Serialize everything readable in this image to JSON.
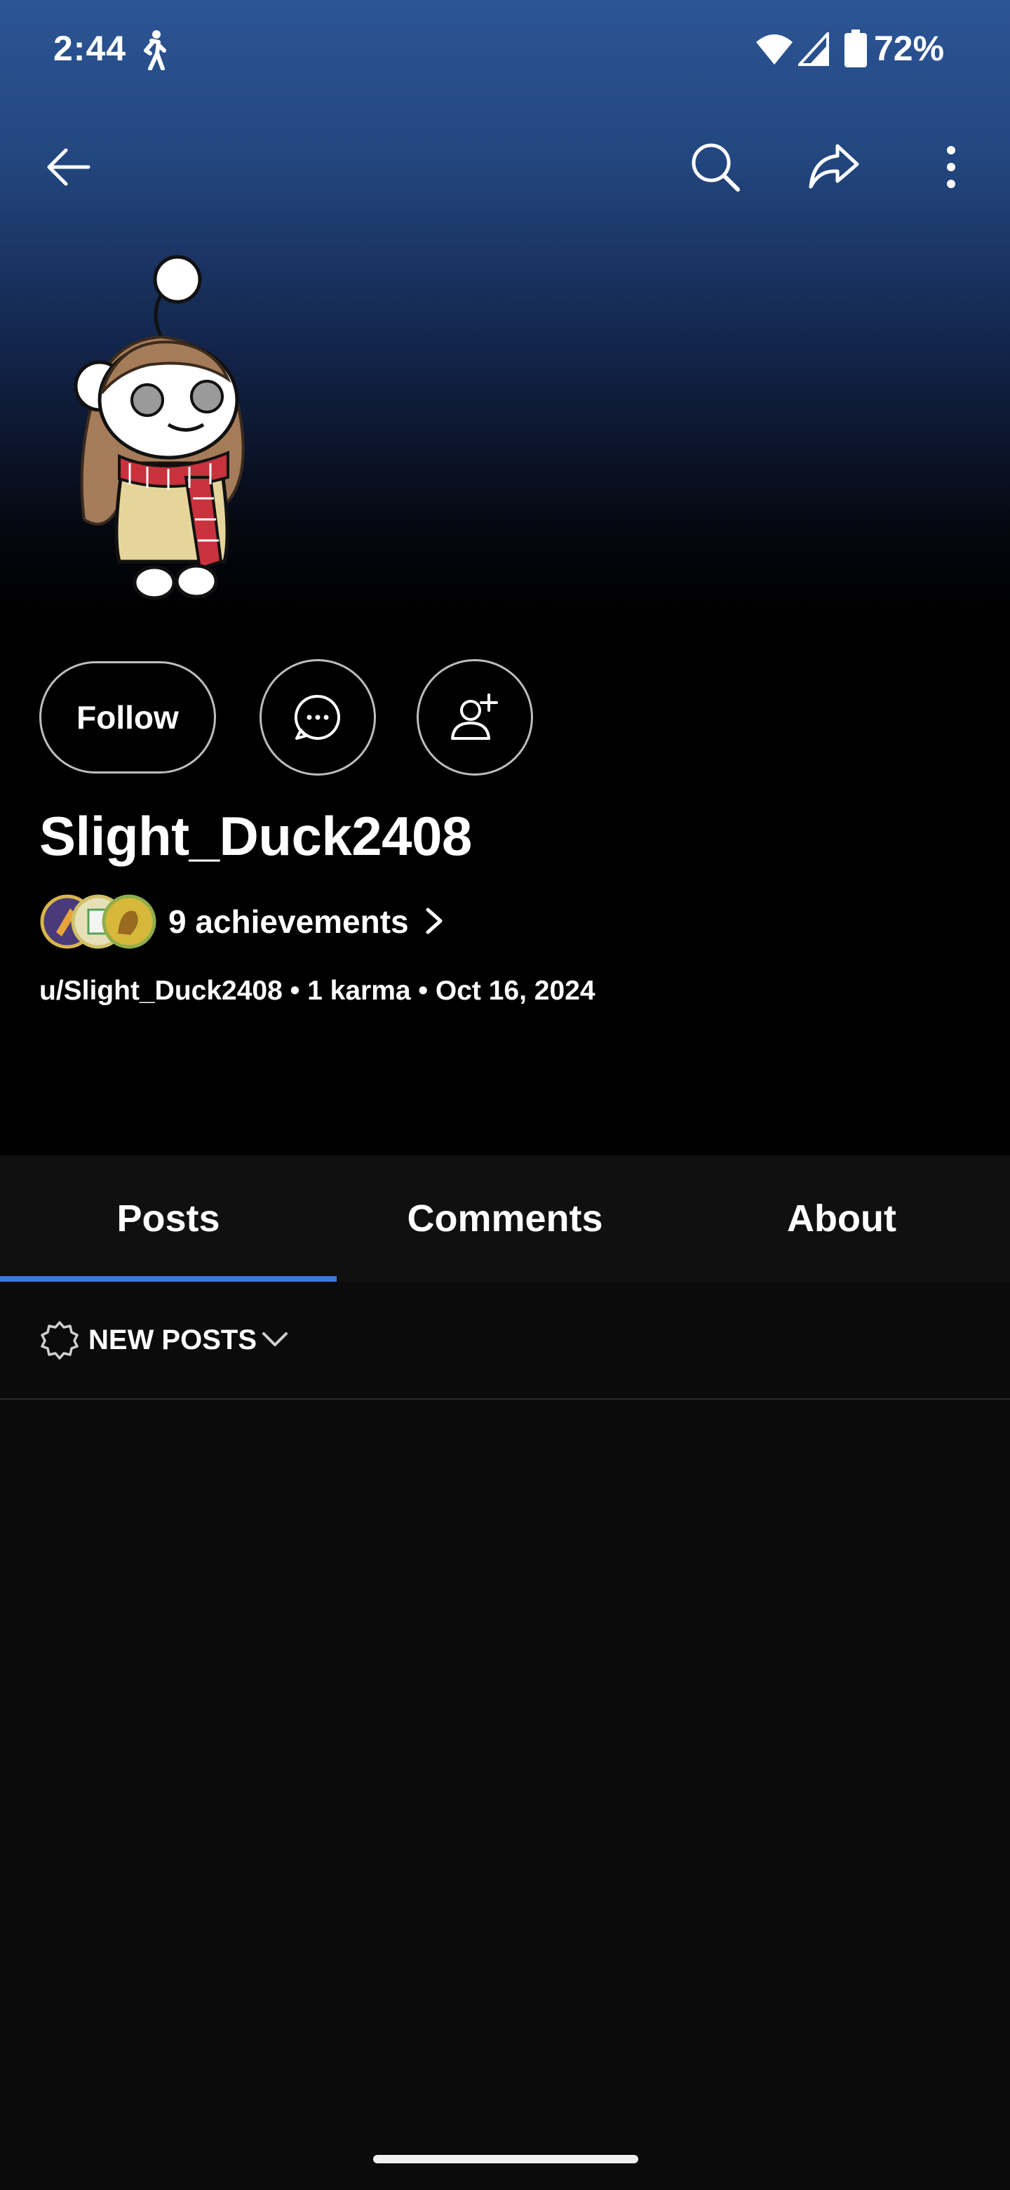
{
  "status_bar": {
    "time": "2:44",
    "battery": "72%",
    "icons": [
      "walk-icon",
      "wifi-icon",
      "signal-icon",
      "battery-icon"
    ]
  },
  "top_nav": {
    "icons": [
      "back-arrow-icon",
      "search-icon",
      "share-icon",
      "more-vertical-icon"
    ]
  },
  "profile": {
    "follow_label": "Follow",
    "username": "Slight_Duck2408",
    "achievements_label": "9 achievements",
    "meta": "u/Slight_Duck2408 • 1 karma • Oct 16, 2024"
  },
  "tabs": [
    {
      "label": "Posts",
      "active": true
    },
    {
      "label": "Comments",
      "active": false
    },
    {
      "label": "About",
      "active": false
    }
  ],
  "sort": {
    "label": "NEW POSTS"
  },
  "colors": {
    "header_gradient_top": "#2c5596",
    "tab_active_underline": "#3a78e0",
    "background": "#0b0b0b"
  }
}
